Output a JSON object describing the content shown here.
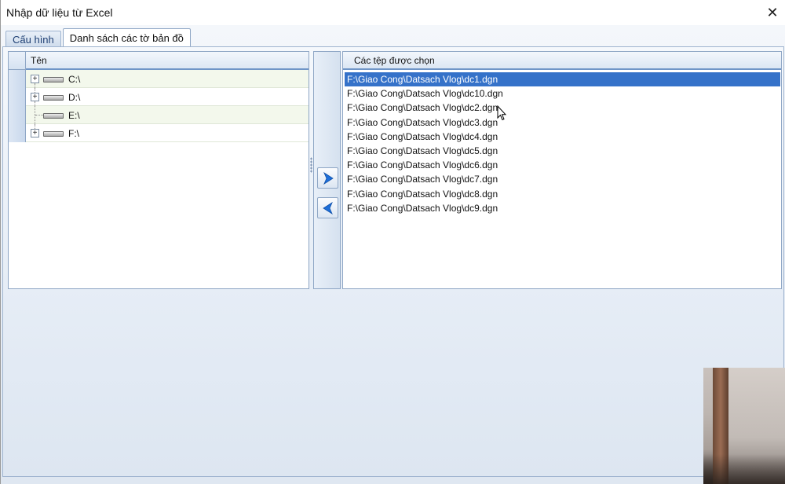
{
  "window": {
    "title": "Nhập dữ liệu từ Excel",
    "close_glyph": "✕"
  },
  "tabs": [
    {
      "label": "Cấu hình",
      "active": false
    },
    {
      "label": "Danh sách các tờ bản đồ",
      "active": true
    }
  ],
  "tree": {
    "header": "Tên",
    "drives": [
      {
        "label": "C:\\",
        "expander": "+"
      },
      {
        "label": "D:\\",
        "expander": "+"
      },
      {
        "label": "E:\\",
        "expander": ""
      },
      {
        "label": "F:\\",
        "expander": "+"
      }
    ]
  },
  "buttons": {
    "add_icon": "arrow-right-icon",
    "remove_icon": "arrow-left-icon"
  },
  "file_list": {
    "header": "Các tệp được chọn",
    "selected_index": 0,
    "files": [
      "F:\\Giao Cong\\Datsach Vlog\\dc1.dgn",
      "F:\\Giao Cong\\Datsach Vlog\\dc10.dgn",
      "F:\\Giao Cong\\Datsach Vlog\\dc2.dgn",
      "F:\\Giao Cong\\Datsach Vlog\\dc3.dgn",
      "F:\\Giao Cong\\Datsach Vlog\\dc4.dgn",
      "F:\\Giao Cong\\Datsach Vlog\\dc5.dgn",
      "F:\\Giao Cong\\Datsach Vlog\\dc6.dgn",
      "F:\\Giao Cong\\Datsach Vlog\\dc7.dgn",
      "F:\\Giao Cong\\Datsach Vlog\\dc8.dgn",
      "F:\\Giao Cong\\Datsach Vlog\\dc9.dgn"
    ]
  },
  "colors": {
    "selection": "#3572c9",
    "accent_blue": "#1e6fd9",
    "border": "#8ea6c5"
  }
}
